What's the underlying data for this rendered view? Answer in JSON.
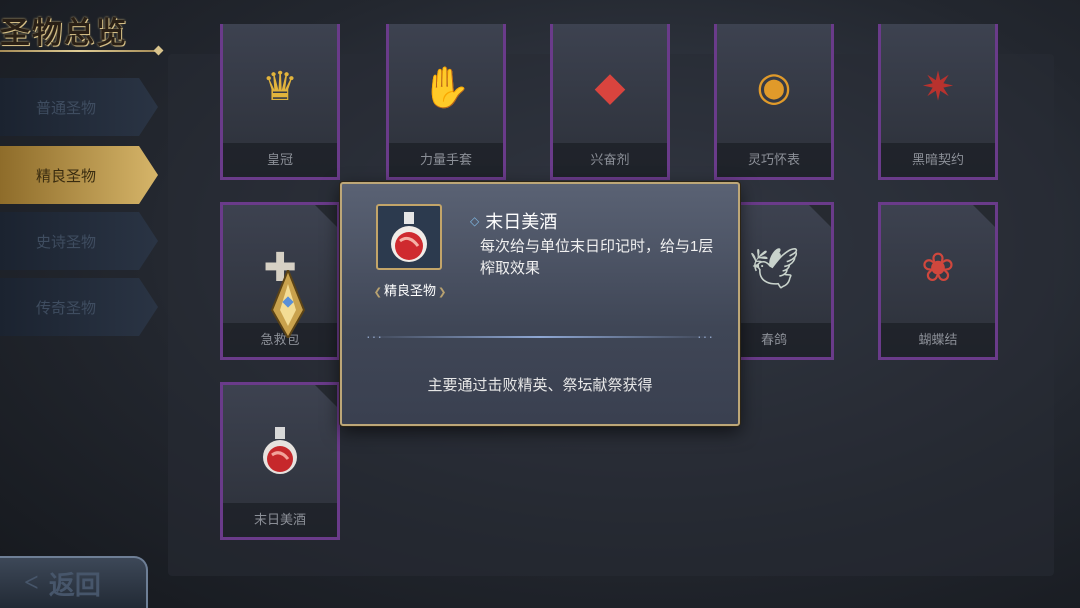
{
  "title": "圣物总览",
  "sidebar": {
    "items": [
      {
        "label": "普通圣物",
        "active": false
      },
      {
        "label": "精良圣物",
        "active": true
      },
      {
        "label": "史诗圣物",
        "active": false
      },
      {
        "label": "传奇圣物",
        "active": false
      }
    ]
  },
  "relics": [
    {
      "name": "皇冠",
      "icon": "crown-icon"
    },
    {
      "name": "力量手套",
      "icon": "glove-icon"
    },
    {
      "name": "兴奋剂",
      "icon": "stimulant-icon"
    },
    {
      "name": "灵巧怀表",
      "icon": "pocket-watch-icon"
    },
    {
      "name": "黑暗契约",
      "icon": "dark-pact-icon"
    },
    {
      "name": "急救包",
      "icon": "first-aid-kit-icon"
    },
    {
      "name": "春鸽",
      "icon": "dove-icon"
    },
    {
      "name": "蝴蝶结",
      "icon": "bow-icon"
    },
    {
      "name": "末日美酒",
      "icon": "potion-icon"
    }
  ],
  "popup": {
    "name": "末日美酒",
    "rarity": "精良圣物",
    "description": "每次给与单位末日印记时，给与1层榨取效果",
    "source": "主要通过击败精英、祭坛献祭获得",
    "dots": "···"
  },
  "back_button": {
    "arrow": "<",
    "label": "返回"
  },
  "colors": {
    "rarity_border": "#6a3b8a",
    "active_tab": "#d6b569",
    "popup_border": "#bda778"
  }
}
